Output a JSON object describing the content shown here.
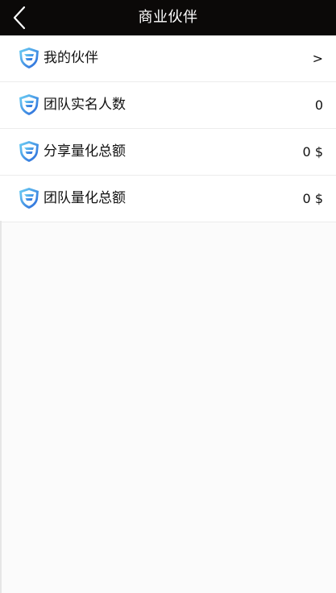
{
  "header": {
    "title": "商业伙伴",
    "back_icon": "chevron-left-icon"
  },
  "list": {
    "items": [
      {
        "label": "我的伙伴",
        "value": ">",
        "icon": "shield-icon"
      },
      {
        "label": "团队实名人数",
        "value": "0",
        "icon": "shield-icon"
      },
      {
        "label": "分享量化总额",
        "value": "0 $",
        "icon": "shield-icon"
      },
      {
        "label": "团队量化总额",
        "value": "0 $",
        "icon": "shield-icon"
      }
    ]
  },
  "colors": {
    "header_bg": "#0b0908",
    "icon_blue": "#2f7de1",
    "icon_blue_light": "#5fc7f2"
  }
}
